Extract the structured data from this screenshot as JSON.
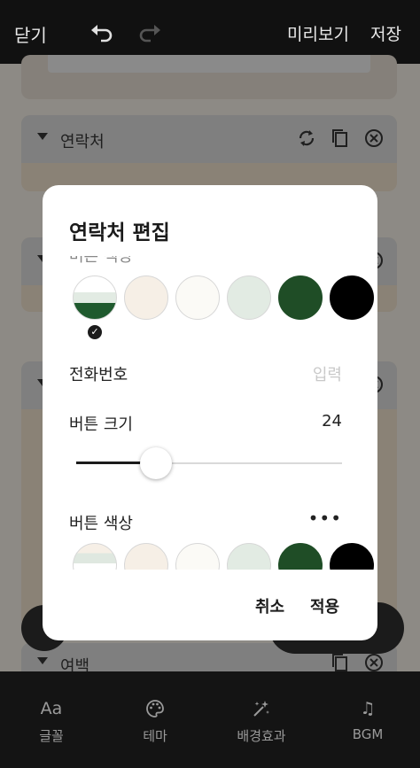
{
  "topbar": {
    "close_label": "닫기",
    "preview_label": "미리보기",
    "save_label": "저장",
    "undo_icon": "undo-icon",
    "redo_icon": "redo-icon"
  },
  "background": {
    "contact_card_title": "연락처",
    "spacing_card_title": "여백"
  },
  "dialog": {
    "title": "연락처 편집",
    "phone_label": "전화번호",
    "phone_placeholder": "입력",
    "button_size_label": "버튼 크기",
    "button_size_value": "24",
    "button_size_fraction": 0.3,
    "button_color_label": "버튼 색상",
    "cancel_label": "취소",
    "apply_label": "적용",
    "theme_swatches": [
      {
        "name": "stripe-green",
        "color": "#1f5a2e",
        "selected": true
      },
      {
        "name": "cream",
        "color": "#f6efe6",
        "selected": false
      },
      {
        "name": "ivory",
        "color": "#fbfaf6",
        "selected": false
      },
      {
        "name": "mint",
        "color": "#e2ebe3",
        "selected": false
      },
      {
        "name": "forest",
        "color": "#1f4d26",
        "selected": false
      },
      {
        "name": "black",
        "color": "#000000",
        "selected": false
      }
    ],
    "button_swatches": [
      {
        "name": "stripe-cream",
        "color": "#dfe8e0"
      },
      {
        "name": "cream",
        "color": "#f6efe6"
      },
      {
        "name": "ivory",
        "color": "#fbfaf6"
      },
      {
        "name": "mint",
        "color": "#e2ebe3"
      },
      {
        "name": "forest",
        "color": "#1f4d26"
      },
      {
        "name": "black",
        "color": "#000000"
      }
    ]
  },
  "bottomnav": {
    "items": [
      {
        "label": "글꼴",
        "icon": "font-icon",
        "glyph": "Aa"
      },
      {
        "label": "테마",
        "icon": "palette-icon",
        "glyph": ""
      },
      {
        "label": "배경효과",
        "icon": "sparkle-icon",
        "glyph": ""
      },
      {
        "label": "BGM",
        "icon": "music-note-icon",
        "glyph": "♫"
      }
    ]
  }
}
